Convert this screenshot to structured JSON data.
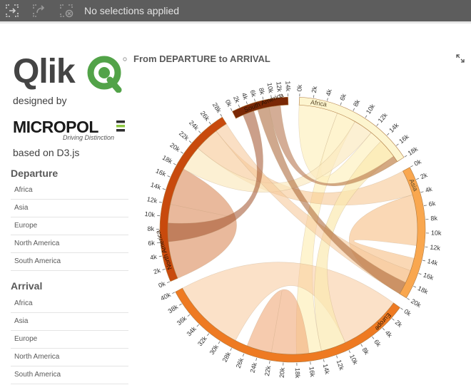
{
  "toolbar": {
    "status": "No selections applied",
    "icons": [
      "smart-search-icon",
      "step-forward-icon",
      "clear-selections-icon"
    ]
  },
  "branding": {
    "qlik_logo": "Qlik",
    "designed_by": "designed by",
    "micropole_logo": "MICROPOLE",
    "micropole_tagline": "Driving Distinction",
    "based_on": "based on D3.js"
  },
  "filters": {
    "departure": {
      "title": "Departure",
      "items": [
        "Africa",
        "Asia",
        "Europe",
        "North America",
        "South America"
      ]
    },
    "arrival": {
      "title": "Arrival",
      "items": [
        "Africa",
        "Asia",
        "Europe",
        "North America",
        "South America"
      ]
    }
  },
  "chart_data": {
    "type": "chord",
    "title": "From DEPARTURE to ARRIVAL",
    "groups": [
      {
        "name": "Africa",
        "color": "#fdf5cf",
        "tick_max": 18,
        "ticks": [
          "0k",
          "2k",
          "4k",
          "6k",
          "8k",
          "10k",
          "12k",
          "14k",
          "16k",
          "18k"
        ]
      },
      {
        "name": "Asia",
        "color": "#f9a74f",
        "tick_max": 20,
        "ticks": [
          "0k",
          "2k",
          "4k",
          "6k",
          "8k",
          "10k",
          "12k",
          "14k",
          "16k",
          "18k",
          "20k"
        ]
      },
      {
        "name": "Europe",
        "color": "#ee7a22",
        "tick_max": 40,
        "ticks": [
          "0k",
          "2k",
          "4k",
          "6k",
          "8k",
          "10k",
          "12k",
          "14k",
          "16k",
          "18k",
          "20k",
          "22k",
          "24k",
          "26k",
          "28k",
          "30k",
          "32k",
          "34k",
          "36k",
          "38k",
          "40k"
        ]
      },
      {
        "name": "North America",
        "color": "#c84a0d",
        "tick_max": 28,
        "ticks": [
          "0k",
          "2k",
          "4k",
          "6k",
          "8k",
          "10k",
          "12k",
          "14k",
          "16k",
          "18k",
          "20k",
          "22k",
          "24k",
          "26k",
          "28k"
        ]
      },
      {
        "name": "South America",
        "color": "#7a2806",
        "tick_max": 14,
        "ticks": [
          "0k",
          "2k",
          "4k",
          "6k",
          "8k",
          "10k",
          "12k",
          "14k"
        ]
      }
    ]
  }
}
